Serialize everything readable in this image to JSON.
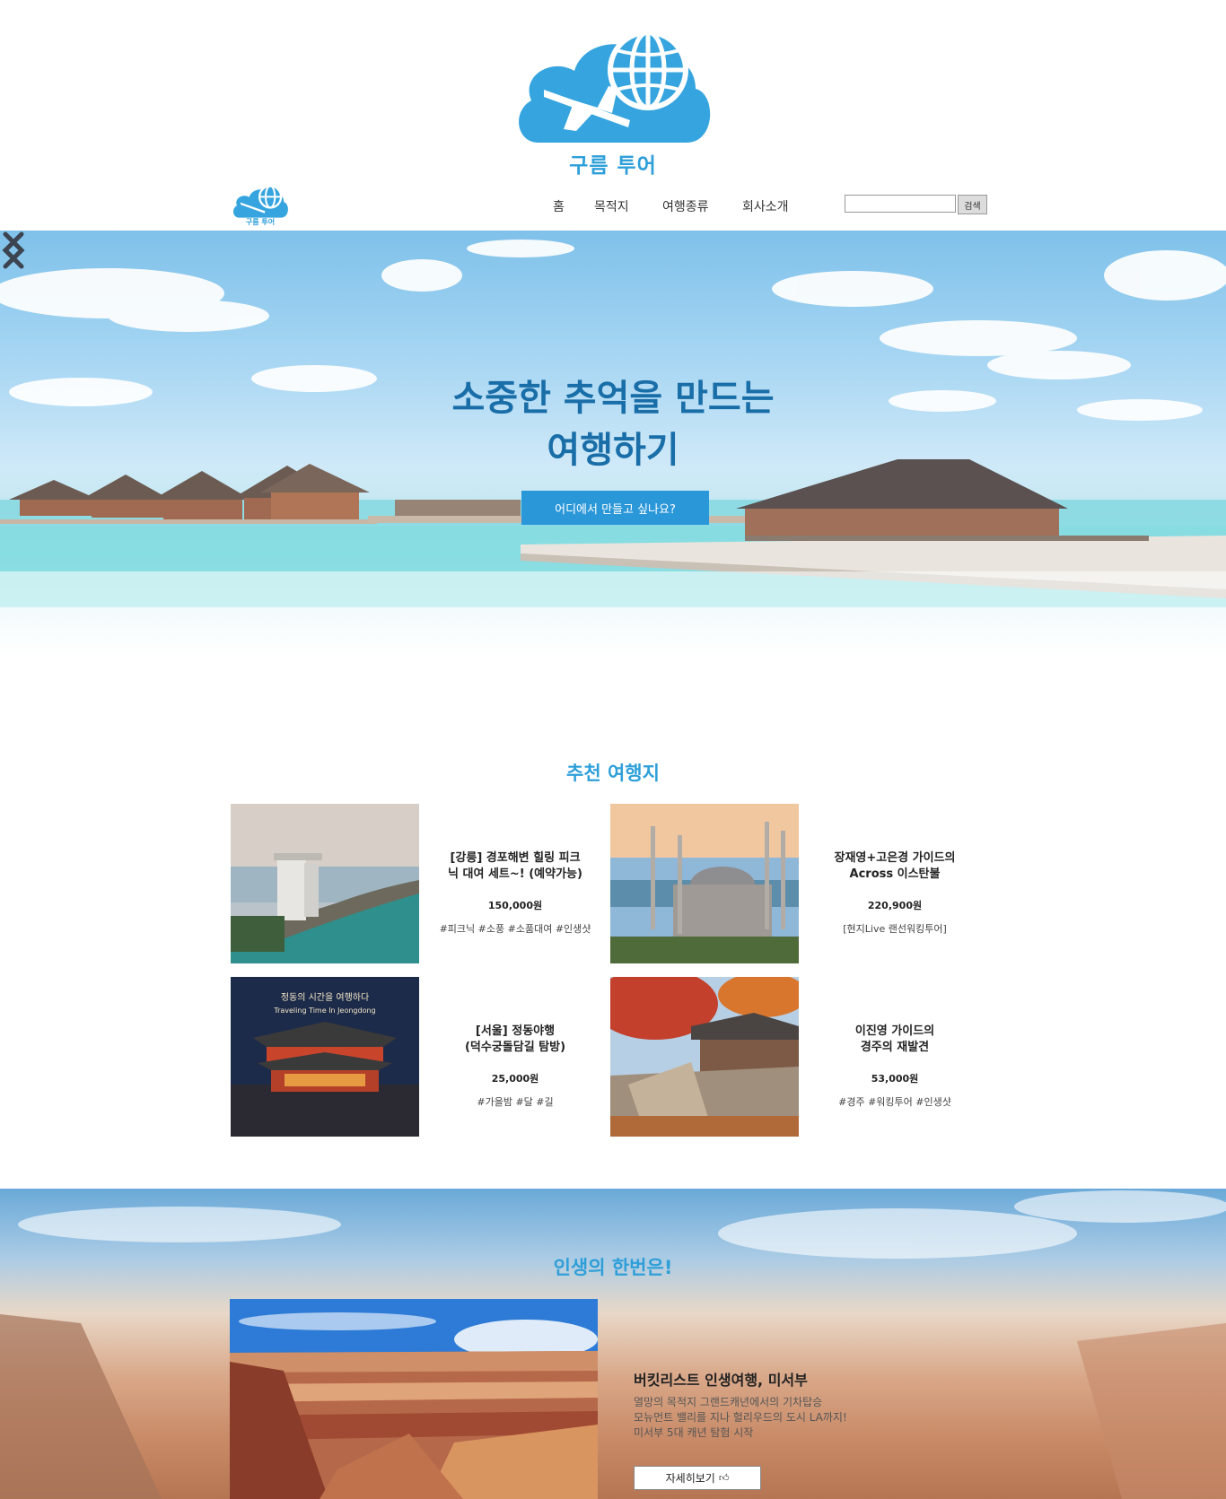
{
  "brand": {
    "name": "구름 투어",
    "accent": "#2e9fd9"
  },
  "nav": {
    "items": [
      {
        "label": "홈"
      },
      {
        "label": "목적지"
      },
      {
        "label": "여행종류"
      },
      {
        "label": "회사소개"
      }
    ],
    "search": {
      "value": "",
      "button": "검색"
    }
  },
  "hero": {
    "title_line1": "소중한 추억을 만드는",
    "title_line2": "여행하기",
    "cta": "어디에서 만들고 싶나요?",
    "prev_icon": "chevron-left-icon",
    "next_icon": "chevron-right-icon"
  },
  "recommended": {
    "title": "추천 여행지",
    "cards": [
      {
        "title_line1": "[강릉] 경포해변 힐링 피크",
        "title_line2": "닉 대여 세트~! (예약가능)",
        "price": "150,000원",
        "tags": "#피크닉 #소풍 #소품대여 #인생샷"
      },
      {
        "title_line1": "장재영+고은경 가이드의",
        "title_line2": "Across 이스탄불",
        "price": "220,900원",
        "tags": "[현지Live 랜선워킹투어]"
      },
      {
        "title_line1": "[서울] 정동야행",
        "title_line2": "(덕수궁돌담길 탐방)",
        "price": "25,000원",
        "tags": "#가을밤 #달 #길",
        "image_caption1": "정동의 시간을 여행하다",
        "image_caption2": "Traveling Time In Jeongdong"
      },
      {
        "title_line1": "이진영 가이드의",
        "title_line2": "경주의 재발견",
        "price": "53,000원",
        "tags": "#경주 #워킹투어 #인생샷"
      }
    ]
  },
  "bucket": {
    "title": "인생의 한번은!",
    "headline": "버킷리스트 인생여행, 미서부",
    "desc_line1": "열망의 목적지 그랜드캐년에서의 기차탑승",
    "desc_line2": "모뉴먼트 밸리를 지나 헐리우드의 도시 LA까지!",
    "desc_line3": "미서부 5대 캐년 탐험 시작",
    "button": "자세히보기"
  }
}
